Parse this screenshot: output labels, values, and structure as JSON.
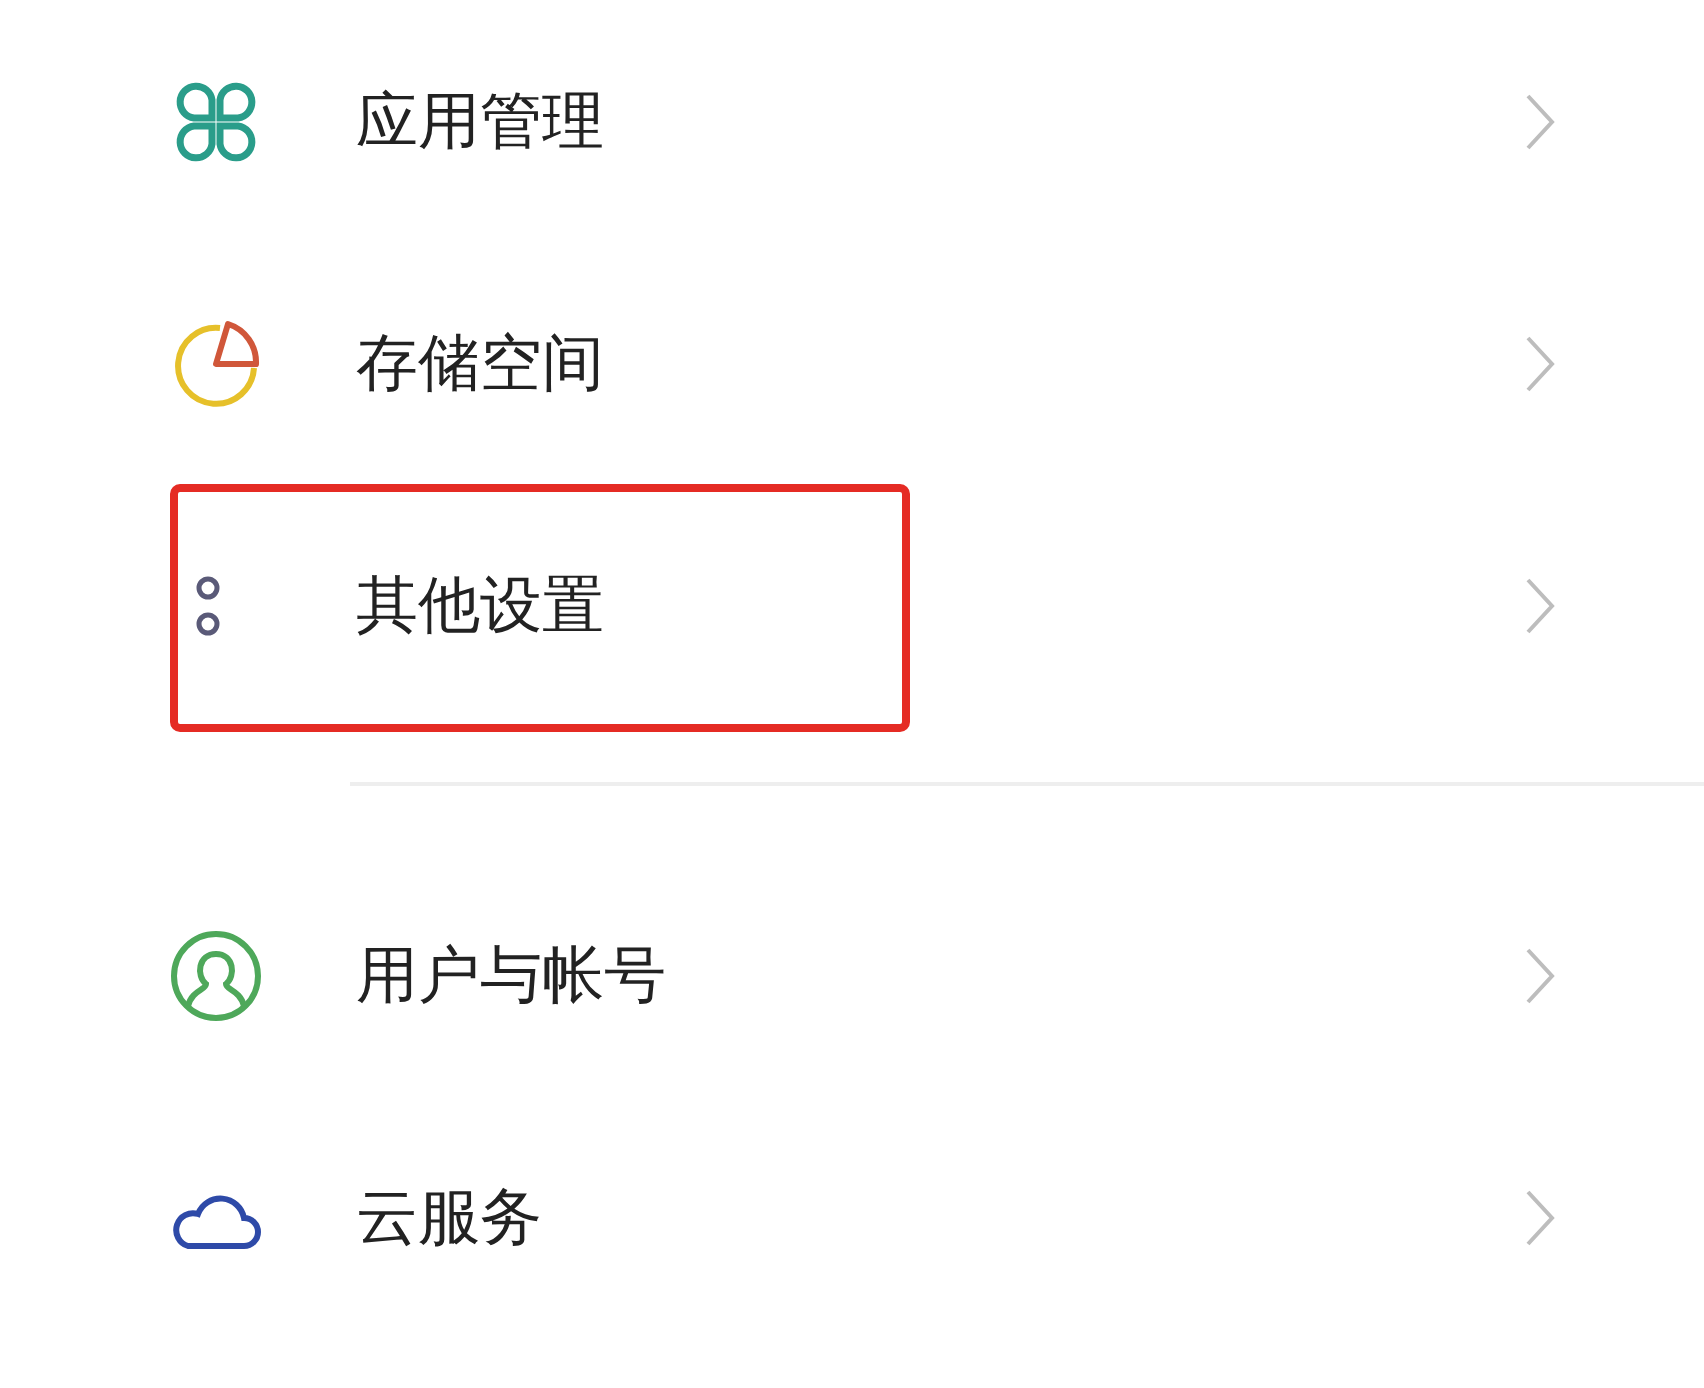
{
  "groups": [
    {
      "items": [
        {
          "kind": "apps",
          "label": "应用管理",
          "highlighted": false
        },
        {
          "kind": "storage",
          "label": "存储空间",
          "highlighted": false
        },
        {
          "kind": "dots",
          "label": "其他设置",
          "highlighted": true
        }
      ]
    },
    {
      "items": [
        {
          "kind": "user",
          "label": "用户与帐号",
          "highlighted": false
        },
        {
          "kind": "cloud",
          "label": "云服务",
          "highlighted": false
        }
      ]
    }
  ]
}
